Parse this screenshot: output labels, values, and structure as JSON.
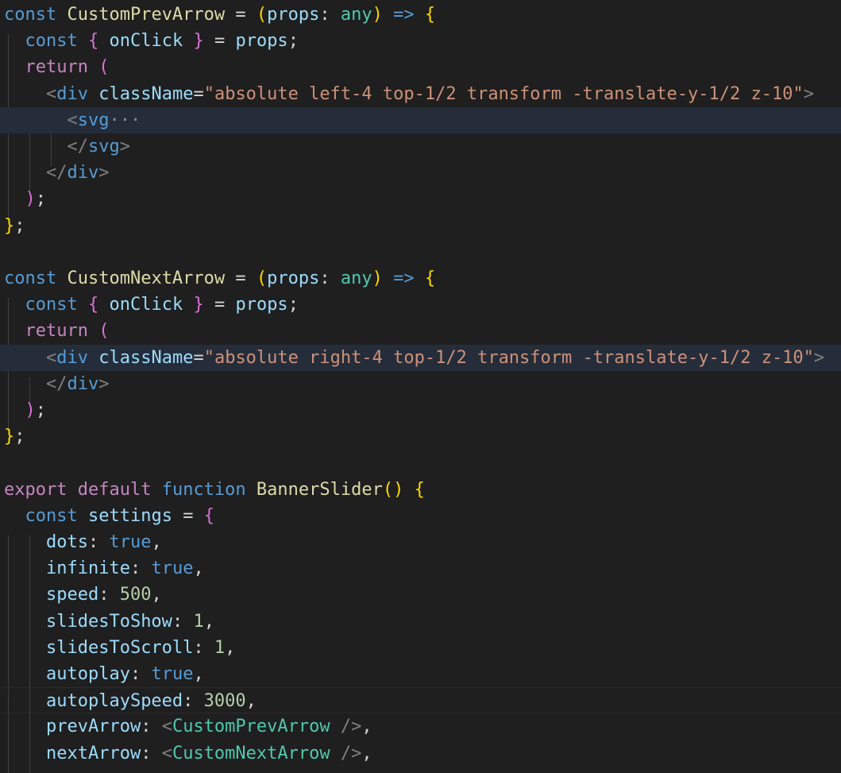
{
  "theme": {
    "background": "#1f1f1f",
    "keyword_storage": "#569cd6",
    "keyword_control": "#c586c0",
    "function": "#dcdcaa",
    "variable": "#9cdcfe",
    "type": "#4ec9b0",
    "string": "#ce9178",
    "number": "#b5cea8",
    "text": "#d4d4d4",
    "tag_punct": "#808080",
    "bracket1": "#ffd700",
    "bracket2": "#da70d6",
    "bracket3": "#179fff",
    "fold_marker": "#8c8c8c"
  },
  "lines": [
    {
      "highlight": "",
      "tokens": [
        {
          "t": "const",
          "c": "storage"
        },
        {
          "t": " ",
          "c": "text"
        },
        {
          "t": "CustomPrevArrow",
          "c": "function"
        },
        {
          "t": " = ",
          "c": "text"
        },
        {
          "t": "(",
          "c": "bracket1"
        },
        {
          "t": "props",
          "c": "variable"
        },
        {
          "t": ": ",
          "c": "text"
        },
        {
          "t": "any",
          "c": "type"
        },
        {
          "t": ")",
          "c": "bracket1"
        },
        {
          "t": " ",
          "c": "text"
        },
        {
          "t": "=>",
          "c": "storage"
        },
        {
          "t": " ",
          "c": "text"
        },
        {
          "t": "{",
          "c": "bracket1"
        }
      ]
    },
    {
      "highlight": "",
      "tokens": [
        {
          "t": "  ",
          "c": "text"
        },
        {
          "t": "const",
          "c": "storage"
        },
        {
          "t": " ",
          "c": "text"
        },
        {
          "t": "{",
          "c": "bracket2"
        },
        {
          "t": " onClick ",
          "c": "variable"
        },
        {
          "t": "}",
          "c": "bracket2"
        },
        {
          "t": " = ",
          "c": "text"
        },
        {
          "t": "props",
          "c": "variable"
        },
        {
          "t": ";",
          "c": "text"
        }
      ]
    },
    {
      "highlight": "",
      "tokens": [
        {
          "t": "  ",
          "c": "text"
        },
        {
          "t": "return",
          "c": "control"
        },
        {
          "t": " ",
          "c": "text"
        },
        {
          "t": "(",
          "c": "bracket2"
        }
      ]
    },
    {
      "highlight": "",
      "tokens": [
        {
          "t": "    ",
          "c": "text"
        },
        {
          "t": "<",
          "c": "tag_punct"
        },
        {
          "t": "div",
          "c": "storage"
        },
        {
          "t": " ",
          "c": "text"
        },
        {
          "t": "className",
          "c": "variable"
        },
        {
          "t": "=",
          "c": "text"
        },
        {
          "t": "\"absolute left-4 top-1/2 transform -translate-y-1/2 z-10\"",
          "c": "string"
        },
        {
          "t": ">",
          "c": "tag_punct"
        }
      ]
    },
    {
      "highlight": "strong",
      "tokens": [
        {
          "t": "      ",
          "c": "text"
        },
        {
          "t": "<",
          "c": "tag_punct"
        },
        {
          "t": "svg",
          "c": "storage"
        },
        {
          "t": "···",
          "c": "fold"
        }
      ]
    },
    {
      "highlight": "",
      "tokens": [
        {
          "t": "      ",
          "c": "text"
        },
        {
          "t": "</",
          "c": "tag_punct"
        },
        {
          "t": "svg",
          "c": "storage"
        },
        {
          "t": ">",
          "c": "tag_punct"
        }
      ]
    },
    {
      "highlight": "",
      "tokens": [
        {
          "t": "    ",
          "c": "text"
        },
        {
          "t": "</",
          "c": "tag_punct"
        },
        {
          "t": "div",
          "c": "storage"
        },
        {
          "t": ">",
          "c": "tag_punct"
        }
      ]
    },
    {
      "highlight": "",
      "tokens": [
        {
          "t": "  ",
          "c": "text"
        },
        {
          "t": ")",
          "c": "bracket2"
        },
        {
          "t": ";",
          "c": "text"
        }
      ]
    },
    {
      "highlight": "",
      "tokens": [
        {
          "t": "}",
          "c": "bracket1"
        },
        {
          "t": ";",
          "c": "text"
        }
      ]
    },
    {
      "highlight": "",
      "tokens": []
    },
    {
      "highlight": "",
      "tokens": [
        {
          "t": "const",
          "c": "storage"
        },
        {
          "t": " ",
          "c": "text"
        },
        {
          "t": "CustomNextArrow",
          "c": "function"
        },
        {
          "t": " = ",
          "c": "text"
        },
        {
          "t": "(",
          "c": "bracket1"
        },
        {
          "t": "props",
          "c": "variable"
        },
        {
          "t": ": ",
          "c": "text"
        },
        {
          "t": "any",
          "c": "type"
        },
        {
          "t": ")",
          "c": "bracket1"
        },
        {
          "t": " ",
          "c": "text"
        },
        {
          "t": "=>",
          "c": "storage"
        },
        {
          "t": " ",
          "c": "text"
        },
        {
          "t": "{",
          "c": "bracket1"
        }
      ]
    },
    {
      "highlight": "",
      "tokens": [
        {
          "t": "  ",
          "c": "text"
        },
        {
          "t": "const",
          "c": "storage"
        },
        {
          "t": " ",
          "c": "text"
        },
        {
          "t": "{",
          "c": "bracket2"
        },
        {
          "t": " onClick ",
          "c": "variable"
        },
        {
          "t": "}",
          "c": "bracket2"
        },
        {
          "t": " = ",
          "c": "text"
        },
        {
          "t": "props",
          "c": "variable"
        },
        {
          "t": ";",
          "c": "text"
        }
      ]
    },
    {
      "highlight": "",
      "tokens": [
        {
          "t": "  ",
          "c": "text"
        },
        {
          "t": "return",
          "c": "control"
        },
        {
          "t": " ",
          "c": "text"
        },
        {
          "t": "(",
          "c": "bracket2"
        }
      ]
    },
    {
      "highlight": "strong",
      "tokens": [
        {
          "t": "    ",
          "c": "text"
        },
        {
          "t": "<",
          "c": "tag_punct"
        },
        {
          "t": "div",
          "c": "storage"
        },
        {
          "t": " ",
          "c": "text"
        },
        {
          "t": "className",
          "c": "variable"
        },
        {
          "t": "=",
          "c": "text"
        },
        {
          "t": "\"absolute right-4 top-1/2 transform -translate-y-1/2 z-10\"",
          "c": "string"
        },
        {
          "t": ">",
          "c": "tag_punct"
        }
      ]
    },
    {
      "highlight": "",
      "tokens": [
        {
          "t": "    ",
          "c": "text"
        },
        {
          "t": "</",
          "c": "tag_punct"
        },
        {
          "t": "div",
          "c": "storage"
        },
        {
          "t": ">",
          "c": "tag_punct"
        }
      ]
    },
    {
      "highlight": "",
      "tokens": [
        {
          "t": "  ",
          "c": "text"
        },
        {
          "t": ")",
          "c": "bracket2"
        },
        {
          "t": ";",
          "c": "text"
        }
      ]
    },
    {
      "highlight": "",
      "tokens": [
        {
          "t": "}",
          "c": "bracket1"
        },
        {
          "t": ";",
          "c": "text"
        }
      ]
    },
    {
      "highlight": "",
      "tokens": []
    },
    {
      "highlight": "",
      "tokens": [
        {
          "t": "export",
          "c": "control"
        },
        {
          "t": " ",
          "c": "text"
        },
        {
          "t": "default",
          "c": "control"
        },
        {
          "t": " ",
          "c": "text"
        },
        {
          "t": "function",
          "c": "storage"
        },
        {
          "t": " ",
          "c": "text"
        },
        {
          "t": "BannerSlider",
          "c": "function"
        },
        {
          "t": "()",
          "c": "bracket1"
        },
        {
          "t": " ",
          "c": "text"
        },
        {
          "t": "{",
          "c": "bracket1"
        }
      ]
    },
    {
      "highlight": "",
      "tokens": [
        {
          "t": "  ",
          "c": "text"
        },
        {
          "t": "const",
          "c": "storage"
        },
        {
          "t": " ",
          "c": "text"
        },
        {
          "t": "settings",
          "c": "variable"
        },
        {
          "t": " = ",
          "c": "text"
        },
        {
          "t": "{",
          "c": "bracket2"
        }
      ]
    },
    {
      "highlight": "",
      "tokens": [
        {
          "t": "    ",
          "c": "text"
        },
        {
          "t": "dots",
          "c": "variable"
        },
        {
          "t": ": ",
          "c": "text"
        },
        {
          "t": "true",
          "c": "storage"
        },
        {
          "t": ",",
          "c": "text"
        }
      ]
    },
    {
      "highlight": "",
      "tokens": [
        {
          "t": "    ",
          "c": "text"
        },
        {
          "t": "infinite",
          "c": "variable"
        },
        {
          "t": ": ",
          "c": "text"
        },
        {
          "t": "true",
          "c": "storage"
        },
        {
          "t": ",",
          "c": "text"
        }
      ]
    },
    {
      "highlight": "",
      "tokens": [
        {
          "t": "    ",
          "c": "text"
        },
        {
          "t": "speed",
          "c": "variable"
        },
        {
          "t": ": ",
          "c": "text"
        },
        {
          "t": "500",
          "c": "number"
        },
        {
          "t": ",",
          "c": "text"
        }
      ]
    },
    {
      "highlight": "",
      "tokens": [
        {
          "t": "    ",
          "c": "text"
        },
        {
          "t": "slidesToShow",
          "c": "variable"
        },
        {
          "t": ": ",
          "c": "text"
        },
        {
          "t": "1",
          "c": "number"
        },
        {
          "t": ",",
          "c": "text"
        }
      ]
    },
    {
      "highlight": "",
      "tokens": [
        {
          "t": "    ",
          "c": "text"
        },
        {
          "t": "slidesToScroll",
          "c": "variable"
        },
        {
          "t": ": ",
          "c": "text"
        },
        {
          "t": "1",
          "c": "number"
        },
        {
          "t": ",",
          "c": "text"
        }
      ]
    },
    {
      "highlight": "",
      "tokens": [
        {
          "t": "    ",
          "c": "text"
        },
        {
          "t": "autoplay",
          "c": "variable"
        },
        {
          "t": ": ",
          "c": "text"
        },
        {
          "t": "true",
          "c": "storage"
        },
        {
          "t": ",",
          "c": "text"
        }
      ]
    },
    {
      "highlight": "cursor",
      "tokens": [
        {
          "t": "    ",
          "c": "text"
        },
        {
          "t": "autoplaySpeed",
          "c": "variable"
        },
        {
          "t": ": ",
          "c": "text"
        },
        {
          "t": "3000",
          "c": "number"
        },
        {
          "t": ",",
          "c": "text"
        }
      ]
    },
    {
      "highlight": "",
      "tokens": [
        {
          "t": "    ",
          "c": "text"
        },
        {
          "t": "prevArrow",
          "c": "variable"
        },
        {
          "t": ": ",
          "c": "text"
        },
        {
          "t": "<",
          "c": "tag_punct"
        },
        {
          "t": "CustomPrevArrow",
          "c": "type"
        },
        {
          "t": " ",
          "c": "text"
        },
        {
          "t": "/>",
          "c": "tag_punct"
        },
        {
          "t": ",",
          "c": "text"
        }
      ]
    },
    {
      "highlight": "",
      "tokens": [
        {
          "t": "    ",
          "c": "text"
        },
        {
          "t": "nextArrow",
          "c": "variable"
        },
        {
          "t": ": ",
          "c": "text"
        },
        {
          "t": "<",
          "c": "tag_punct"
        },
        {
          "t": "CustomNextArrow",
          "c": "type"
        },
        {
          "t": " ",
          "c": "text"
        },
        {
          "t": "/>",
          "c": "tag_punct"
        },
        {
          "t": ",",
          "c": "text"
        }
      ]
    }
  ]
}
